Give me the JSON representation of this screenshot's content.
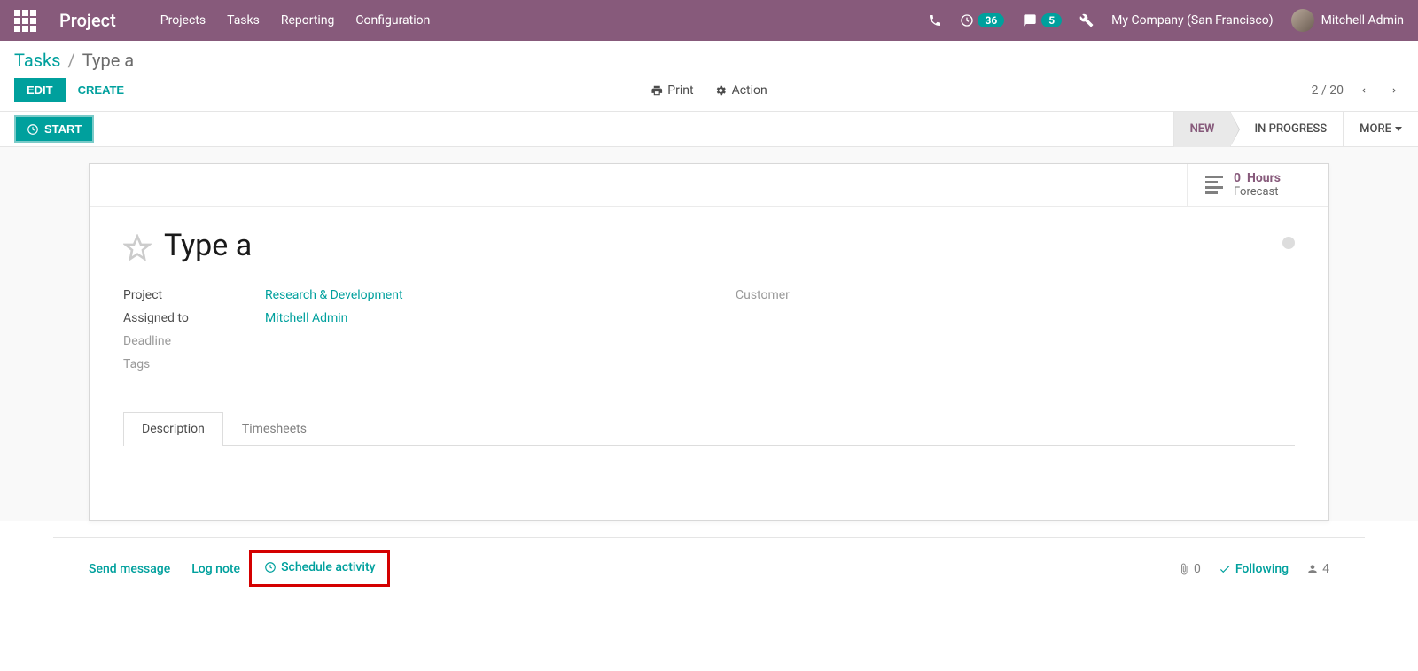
{
  "nav": {
    "app_title": "Project",
    "menu": [
      "Projects",
      "Tasks",
      "Reporting",
      "Configuration"
    ],
    "activities_count": "36",
    "messages_count": "5",
    "company": "My Company (San Francisco)",
    "user": "Mitchell Admin"
  },
  "breadcrumb": {
    "root": "Tasks",
    "current": "Type a"
  },
  "controls": {
    "edit": "EDIT",
    "create": "CREATE",
    "print": "Print",
    "action": "Action",
    "pager": "2 / 20"
  },
  "statusbar": {
    "start": "START",
    "stages": {
      "new": "NEW",
      "in_progress": "IN PROGRESS",
      "more": "MORE"
    }
  },
  "stat": {
    "hours_num": "0",
    "hours_unit": "Hours",
    "forecast": "Forecast"
  },
  "task": {
    "title": "Type a",
    "fields": {
      "project_label": "Project",
      "project_value": "Research & Development",
      "assigned_label": "Assigned to",
      "assigned_value": "Mitchell Admin",
      "deadline_label": "Deadline",
      "tags_label": "Tags",
      "customer_label": "Customer"
    }
  },
  "tabs": {
    "description": "Description",
    "timesheets": "Timesheets"
  },
  "chatter": {
    "send": "Send message",
    "log": "Log note",
    "schedule": "Schedule activity",
    "attach_count": "0",
    "following": "Following",
    "follower_count": "4"
  }
}
